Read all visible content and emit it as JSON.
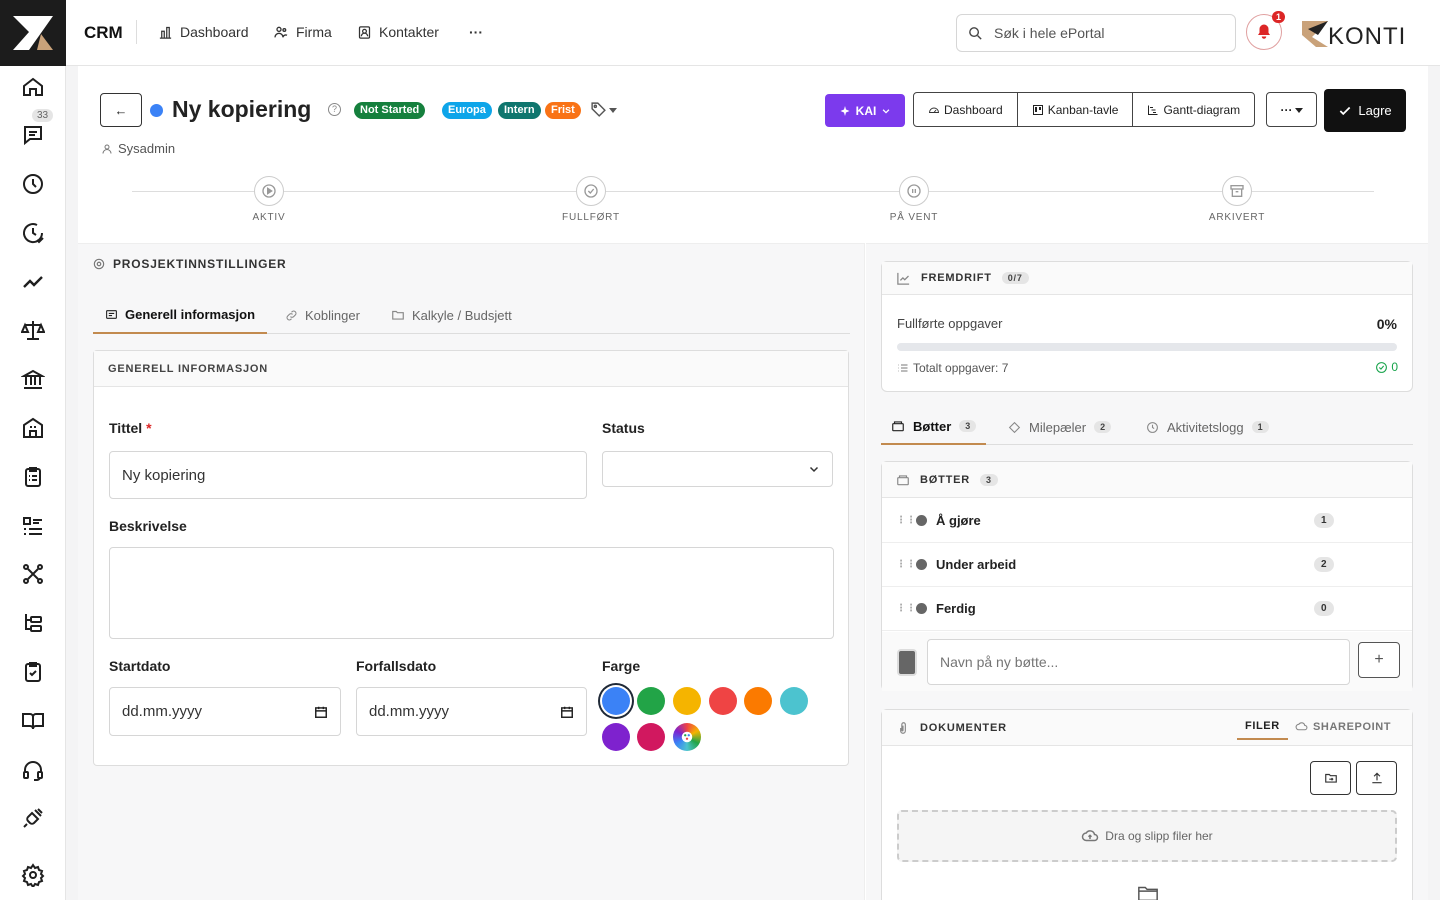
{
  "app": {
    "name": "CRM",
    "brand_logo": "KONTI"
  },
  "nav": [
    {
      "label": "Dashboard",
      "icon": "chart-bar-icon"
    },
    {
      "label": "Firma",
      "icon": "users-icon"
    },
    {
      "label": "Kontakter",
      "icon": "contacts-icon"
    }
  ],
  "nav_more": "···",
  "search": {
    "placeholder": "Søk i hele ePortal"
  },
  "notifications": {
    "count": "1"
  },
  "sidebar": {
    "chat_badge": "33"
  },
  "project": {
    "back_label": "←",
    "title": "Ny kopiering",
    "dot_color": "#3b82f6",
    "tags": [
      {
        "label": "Not Started",
        "color": "#15803d"
      },
      {
        "label": "Europa",
        "color": "#0ea5e9"
      },
      {
        "label": "Intern",
        "color": "#0f766e"
      },
      {
        "label": "Frist",
        "color": "#f97316"
      }
    ],
    "owner": "Sysadmin"
  },
  "toolbar": {
    "kai": "KAI",
    "views": [
      "Dashboard",
      "Kanban-tavle",
      "Gantt-diagram"
    ],
    "more": "···",
    "save": "Lagre"
  },
  "stages": [
    "AKTIV",
    "FULLFØRT",
    "PÅ VENT",
    "ARKIVERT"
  ],
  "settings": {
    "title": "PROSJEKTINNSTILLINGER",
    "tabs": [
      "Generell informasjon",
      "Koblinger",
      "Kalkyle / Budsjett"
    ],
    "card_title": "GENERELL INFORMASJON",
    "fields": {
      "title_label": "Tittel",
      "required_mark": "*",
      "title_value": "Ny kopiering",
      "status_label": "Status",
      "status_value": "",
      "desc_label": "Beskrivelse",
      "desc_value": "",
      "start_label": "Startdato",
      "start_placeholder": "dd.mm.yyyy",
      "due_label": "Forfallsdato",
      "due_placeholder": "dd.mm.yyyy",
      "color_label": "Farge"
    },
    "colors": [
      "#3b82f6",
      "#22a447",
      "#f5b400",
      "#ef4444",
      "#fb7a00",
      "#4cc3cf",
      "#7e22ce",
      "#d1185f"
    ],
    "selected_color": "#3b82f6"
  },
  "progress": {
    "title": "FREMDRIFT",
    "badge": "0/7",
    "label": "Fullførte oppgaver",
    "percent": "0%",
    "fraction": 0,
    "total": "Totalt oppgaver: 7",
    "done": "0"
  },
  "right_tabs": [
    {
      "label": "Bøtter",
      "count": "3"
    },
    {
      "label": "Milepæler",
      "count": "2"
    },
    {
      "label": "Aktivitetslogg",
      "count": "1"
    }
  ],
  "buckets": {
    "title": "BØTTER",
    "count": "3",
    "items": [
      {
        "name": "Å gjøre",
        "count": "1"
      },
      {
        "name": "Under arbeid",
        "count": "2"
      },
      {
        "name": "Ferdig",
        "count": "0"
      }
    ],
    "new_placeholder": "Navn på ny bøtte...",
    "add": "+"
  },
  "documents": {
    "title": "DOKUMENTER",
    "tab_files": "FILER",
    "tab_sharepoint": "SHAREPOINT",
    "dropzone": "Dra og slipp filer her"
  }
}
